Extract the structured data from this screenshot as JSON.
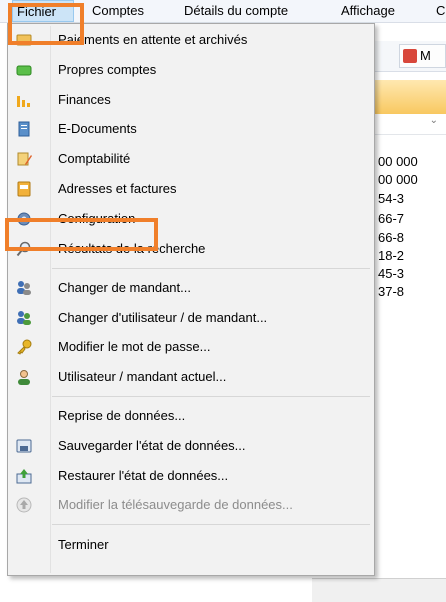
{
  "menubar": {
    "items": [
      "Fichier",
      "Comptes",
      "Détails du compte",
      "Affichage",
      "C"
    ]
  },
  "background": {
    "toolbar_button_label": "M",
    "rows": [
      "00 000",
      "00 000",
      "54-3",
      "66-7",
      "66-8",
      "18-2",
      "45-3",
      "37-8"
    ]
  },
  "dropdown": {
    "items": [
      "Paiements en attente et archivés",
      "Propres comptes",
      "Finances",
      "E-Documents",
      "Comptabilité",
      "Adresses et factures",
      "Configuration",
      "Résultats de la recherche",
      "Changer de mandant...",
      "Changer d'utilisateur / de mandant...",
      "Modifier le mot de passe...",
      "Utilisateur / mandant actuel...",
      "Reprise de données...",
      "Sauvegarder l'état de données...",
      "Restaurer l'état de données...",
      "Modifier la télésauvegarde de données...",
      "Terminer"
    ]
  },
  "colors": {
    "highlight": "#f07f2a",
    "menu_bg": "#f2f2f2",
    "disabled_text": "#8c8c8c"
  }
}
